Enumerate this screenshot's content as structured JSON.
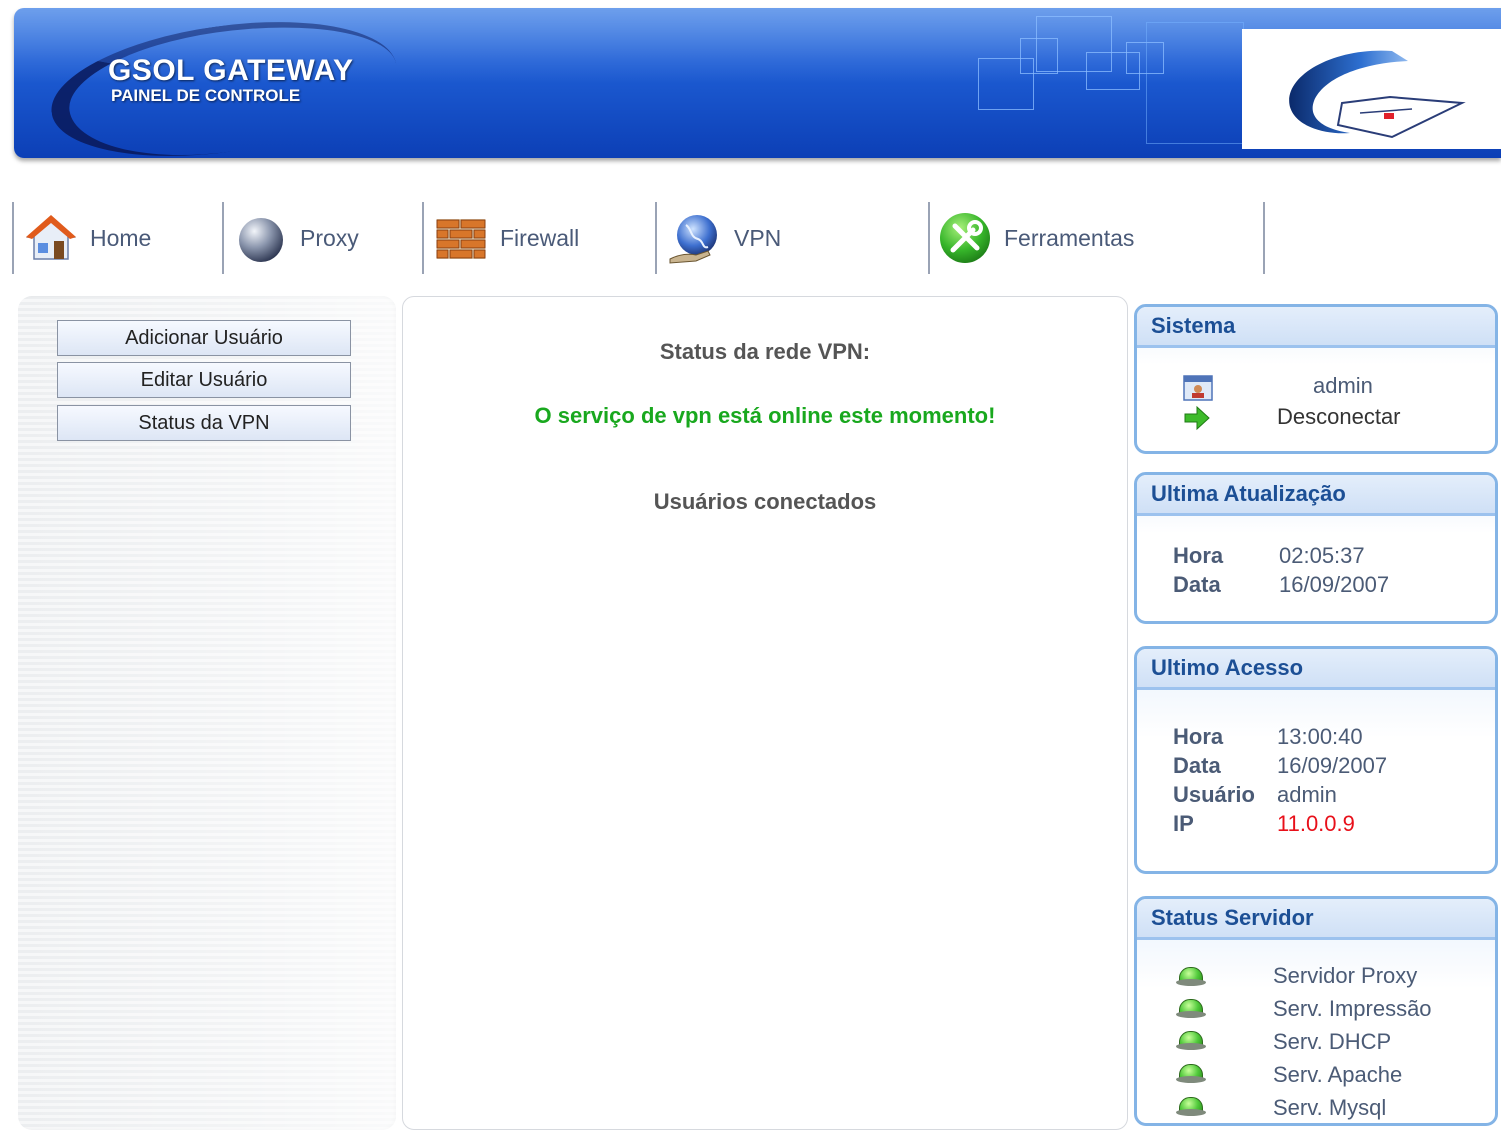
{
  "header": {
    "title": "GSOL GATEWAY",
    "subtitle": "PAINEL DE CONTROLE",
    "logo_icon": "gsol-logo-icon"
  },
  "nav": {
    "items": [
      {
        "label": "Home",
        "icon": "home-icon"
      },
      {
        "label": "Proxy",
        "icon": "globe-sphere-icon"
      },
      {
        "label": "Firewall",
        "icon": "brick-wall-icon"
      },
      {
        "label": "VPN",
        "icon": "vpn-globe-icon"
      },
      {
        "label": "Ferramentas",
        "icon": "tools-icon"
      }
    ]
  },
  "sidebar": {
    "buttons": [
      {
        "label": "Adicionar Usuário"
      },
      {
        "label": "Editar Usuário"
      },
      {
        "label": "Status da VPN"
      }
    ]
  },
  "main": {
    "title": "Status da rede VPN:",
    "message": "O serviço de vpn está online este momento!",
    "message_color": "#19a81e",
    "users_title": "Usuários conectados"
  },
  "sistema": {
    "title": "Sistema",
    "user": "admin",
    "logout": "Desconectar"
  },
  "ultima_atualizacao": {
    "title": "Ultima Atualização",
    "hora_label": "Hora",
    "hora": "02:05:37",
    "data_label": "Data",
    "data": "16/09/2007"
  },
  "ultimo_acesso": {
    "title": "Ultimo Acesso",
    "hora_label": "Hora",
    "hora": "13:00:40",
    "data_label": "Data",
    "data": "16/09/2007",
    "usuario_label": "Usuário",
    "usuario": "admin",
    "ip_label": "IP",
    "ip": "11.0.0.9",
    "ip_color": "#e8101a"
  },
  "status_servidor": {
    "title": "Status Servidor",
    "servers": [
      {
        "name": "Servidor Proxy",
        "status": "online"
      },
      {
        "name": "Serv. Impressão",
        "status": "online"
      },
      {
        "name": "Serv. DHCP",
        "status": "online"
      },
      {
        "name": "Serv. Apache",
        "status": "online"
      },
      {
        "name": "Serv. Mysql",
        "status": "online"
      }
    ]
  }
}
